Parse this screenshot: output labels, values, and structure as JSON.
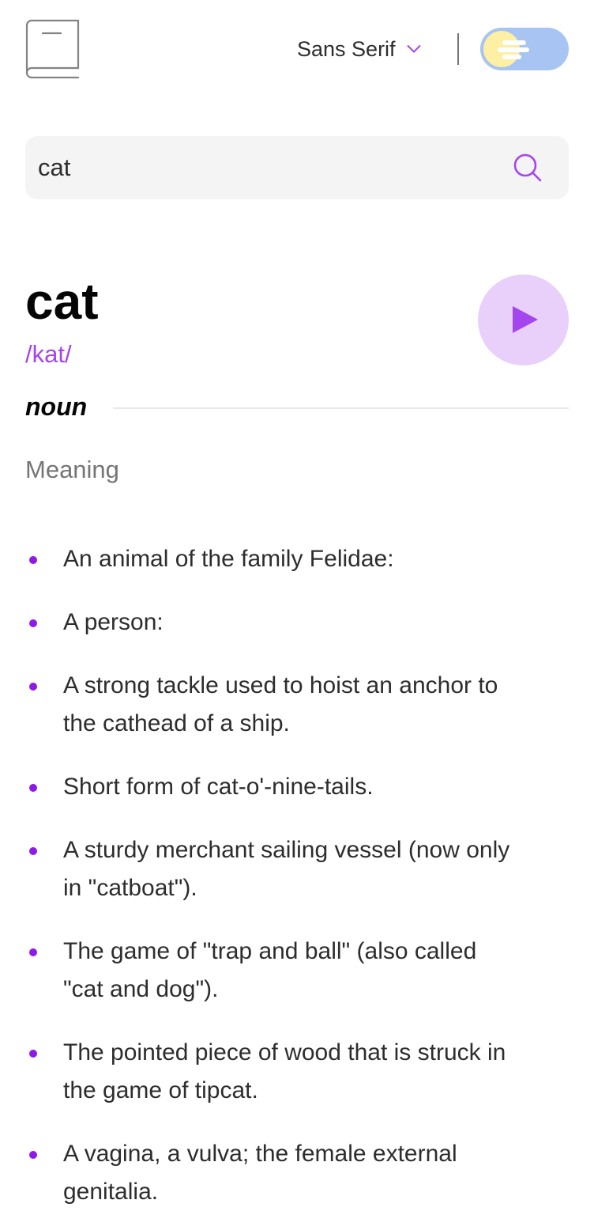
{
  "header": {
    "font_label": "Sans Serif",
    "theme_toggle": "light"
  },
  "search": {
    "value": "cat",
    "placeholder": ""
  },
  "entry": {
    "word": "cat",
    "phonetic": "/kat/",
    "part_of_speech": "noun",
    "meaning_heading": "Meaning",
    "definitions": [
      "An animal of the family Felidae:",
      "A person:",
      "A strong tackle used to hoist an anchor to the cathead of a ship.",
      "Short form of cat-o'-nine-tails.",
      "A sturdy merchant sailing vessel (now only in \"catboat\").",
      "The game of \"trap and ball\" (also called \"cat and dog\").",
      "The pointed piece of wood that is struck in the game of tipcat.",
      "A vagina, a vulva; the female external genitalia."
    ]
  },
  "colors": {
    "accent": "#a445ed",
    "play_bg": "#e9d0fa",
    "toggle_bg": "#a7c4f2",
    "toggle_knob": "#fdf0a4",
    "search_bg": "#f4f4f4"
  },
  "icons": {
    "logo": "book-icon",
    "dropdown": "chevron-down-icon",
    "search": "search-icon",
    "play": "play-icon",
    "theme": "theme-toggle"
  }
}
